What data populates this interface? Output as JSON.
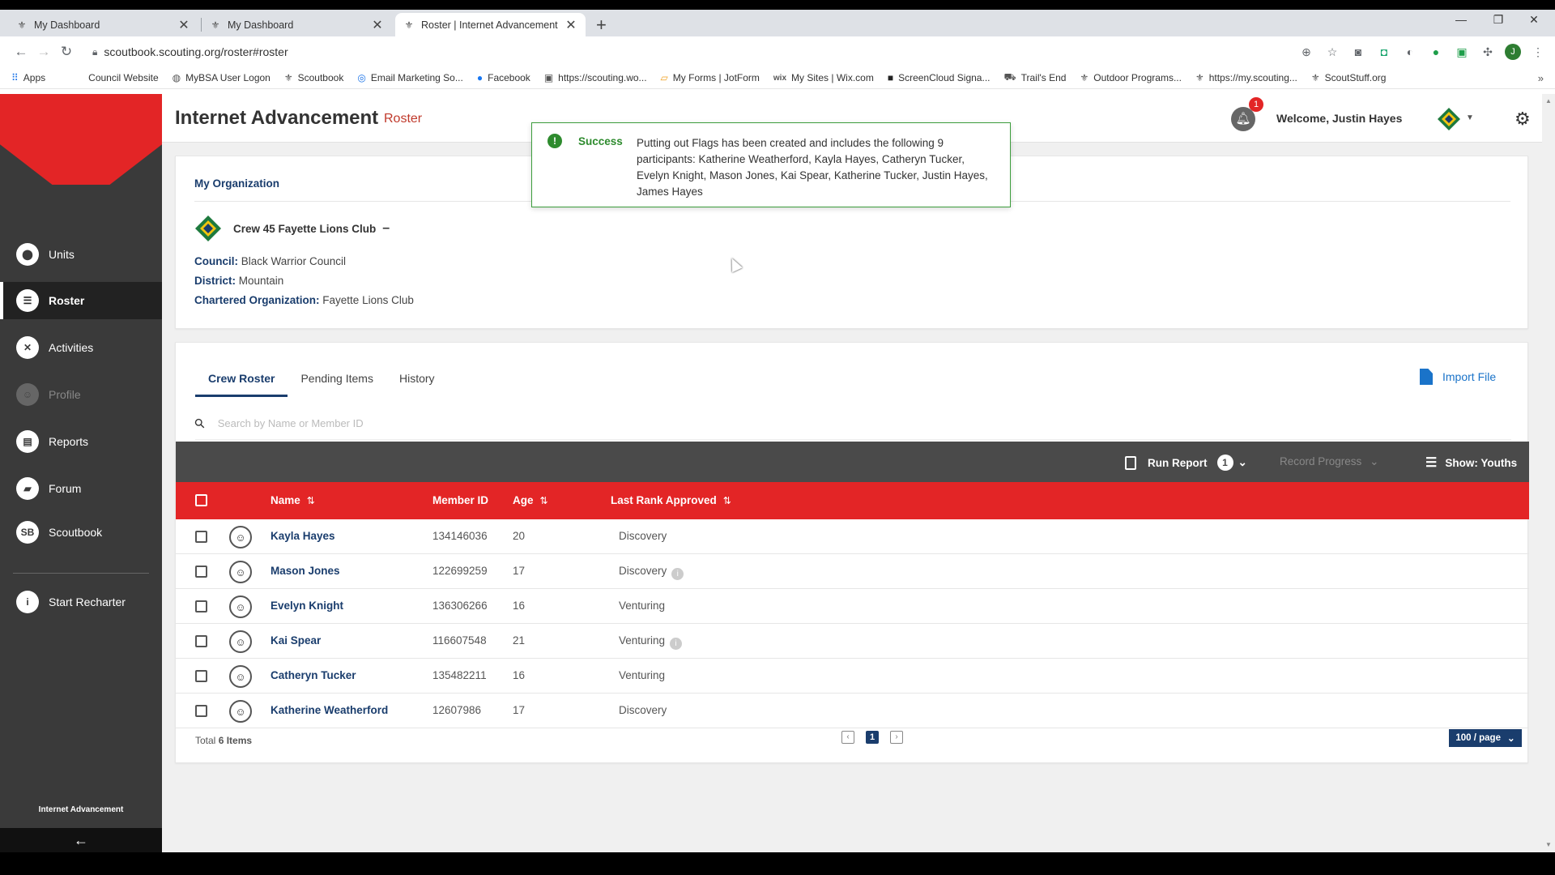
{
  "browser": {
    "tabs": [
      {
        "title": "My Dashboard",
        "close": "✕"
      },
      {
        "title": "My Dashboard",
        "close": "✕"
      },
      {
        "title": "Roster | Internet Advancement",
        "close": "✕"
      }
    ],
    "new_tab": "+",
    "window_controls": {
      "minimize": "—",
      "restore": "❐",
      "close": "✕"
    },
    "url": "scoutbook.scouting.org/roster#roster",
    "profile_initial": "J",
    "bookmarks": [
      {
        "label": "Apps",
        "icon": "apps-grid-icon"
      },
      {
        "label": "Council Website",
        "icon": "none"
      },
      {
        "label": "MyBSA User Logon",
        "icon": "globe-icon"
      },
      {
        "label": "Scoutbook",
        "icon": "fleur-icon"
      },
      {
        "label": "Email Marketing So...",
        "icon": "email-icon"
      },
      {
        "label": "Facebook",
        "icon": "facebook-icon"
      },
      {
        "label": "https://scouting.wo...",
        "icon": "page-icon"
      },
      {
        "label": "My Forms | JotForm",
        "icon": "jotform-icon"
      },
      {
        "label": "My Sites | Wix.com",
        "icon": "wix-icon"
      },
      {
        "label": "ScreenCloud Signa...",
        "icon": "screencloud-icon"
      },
      {
        "label": "Trail's End",
        "icon": "trails-end-icon"
      },
      {
        "label": "Outdoor Programs...",
        "icon": "fleur-icon"
      },
      {
        "label": "https://my.scouting...",
        "icon": "fleur-icon"
      },
      {
        "label": "ScoutStuff.org",
        "icon": "fleur-icon"
      }
    ],
    "bookmarks_more": "»"
  },
  "sidebar": {
    "items": [
      {
        "label": "Units",
        "icon": "location-pin-icon"
      },
      {
        "label": "Roster",
        "icon": "list-icon"
      },
      {
        "label": "Activities",
        "icon": "activities-icon"
      },
      {
        "label": "Profile",
        "icon": "profile-icon"
      },
      {
        "label": "Reports",
        "icon": "clipboard-icon"
      },
      {
        "label": "Forum",
        "icon": "forum-icon"
      },
      {
        "label": "Scoutbook",
        "icon": "SB"
      },
      {
        "label": "Start Recharter",
        "icon": "info-icon"
      }
    ],
    "footer": "Internet Advancement",
    "back": "←"
  },
  "header": {
    "title": "Internet Advancement",
    "crumb": "Roster",
    "notification_count": "1",
    "welcome": "Welcome, Justin Hayes"
  },
  "organization": {
    "heading": "My Organization",
    "unit_name": "Crew 45 Fayette Lions Club",
    "unit_dash": "–",
    "council_label": "Council:",
    "council": "Black Warrior Council",
    "district_label": "District:",
    "district": "Mountain",
    "chartered_label": "Chartered Organization:",
    "chartered": "Fayette Lions Club"
  },
  "toast": {
    "title": "Success",
    "message": "Putting out Flags has been created and includes the following 9 participants: Katherine Weatherford, Kayla Hayes, Catheryn Tucker, Evelyn Knight, Mason Jones, Kai Spear, Katherine Tucker, Justin Hayes, James Hayes"
  },
  "roster": {
    "tabs": [
      "Crew Roster",
      "Pending Items",
      "History"
    ],
    "import_label": "Import File",
    "search_placeholder": "Search by Name or Member ID",
    "actions": {
      "run_report": "Run Report",
      "run_report_count": "1",
      "record_progress": "Record Progress",
      "show": "Show: Youths"
    },
    "columns": {
      "name": "Name",
      "member_id": "Member ID",
      "age": "Age",
      "last_rank": "Last Rank Approved"
    },
    "rows": [
      {
        "name": "Kayla Hayes",
        "member_id": "134146036",
        "age": "20",
        "rank": "Discovery",
        "info": false
      },
      {
        "name": "Mason Jones",
        "member_id": "122699259",
        "age": "17",
        "rank": "Discovery",
        "info": true
      },
      {
        "name": "Evelyn Knight",
        "member_id": "136306266",
        "age": "16",
        "rank": "Venturing",
        "info": false
      },
      {
        "name": "Kai Spear",
        "member_id": "116607548",
        "age": "21",
        "rank": "Venturing",
        "info": true
      },
      {
        "name": "Catheryn Tucker",
        "member_id": "135482211",
        "age": "16",
        "rank": "Venturing",
        "info": false
      },
      {
        "name": "Katherine Weatherford",
        "member_id": "12607986",
        "age": "17",
        "rank": "Discovery",
        "info": false
      }
    ],
    "total_prefix": "Total",
    "total_count": "6 Items",
    "current_page": "1",
    "per_page": "100 / page"
  },
  "colors": {
    "brand_red": "#e32526",
    "navy": "#1a3d6d",
    "success_green": "#2e8b2e",
    "sidebar_bg": "#3a3a3a"
  }
}
